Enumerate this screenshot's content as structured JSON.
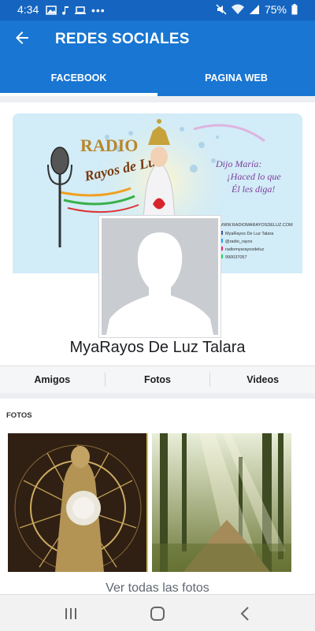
{
  "status_bar": {
    "time": "4:34",
    "battery": "75%"
  },
  "app_bar": {
    "title": "REDES SOCIALES"
  },
  "tabs": [
    {
      "label": "FACEBOOK",
      "selected": true
    },
    {
      "label": "PAGINA WEB",
      "selected": false
    }
  ],
  "profile": {
    "name": "MyaRayos De Luz Talara",
    "cover_text": {
      "brand_top": "RADIO",
      "brand_bottom": "Rayos de Luz",
      "quote": [
        "Dijo María:",
        "¡Haced lo que",
        "Él les diga!"
      ],
      "contacts": [
        "WWW.RADIOMARAYOSDELUZ.COM",
        "MyaRayos De Luz Talara",
        "@radio_rayos",
        "radiomyarayosdeluz",
        "990037057"
      ]
    }
  },
  "actions": [
    {
      "label": "Amigos"
    },
    {
      "label": "Fotos"
    },
    {
      "label": "Videos"
    }
  ],
  "photos": {
    "section_label": "FOTOS",
    "see_all": "Ver todas las fotos"
  },
  "colors": {
    "status_bar": "#1565c0",
    "app_bar": "#1976d2"
  }
}
